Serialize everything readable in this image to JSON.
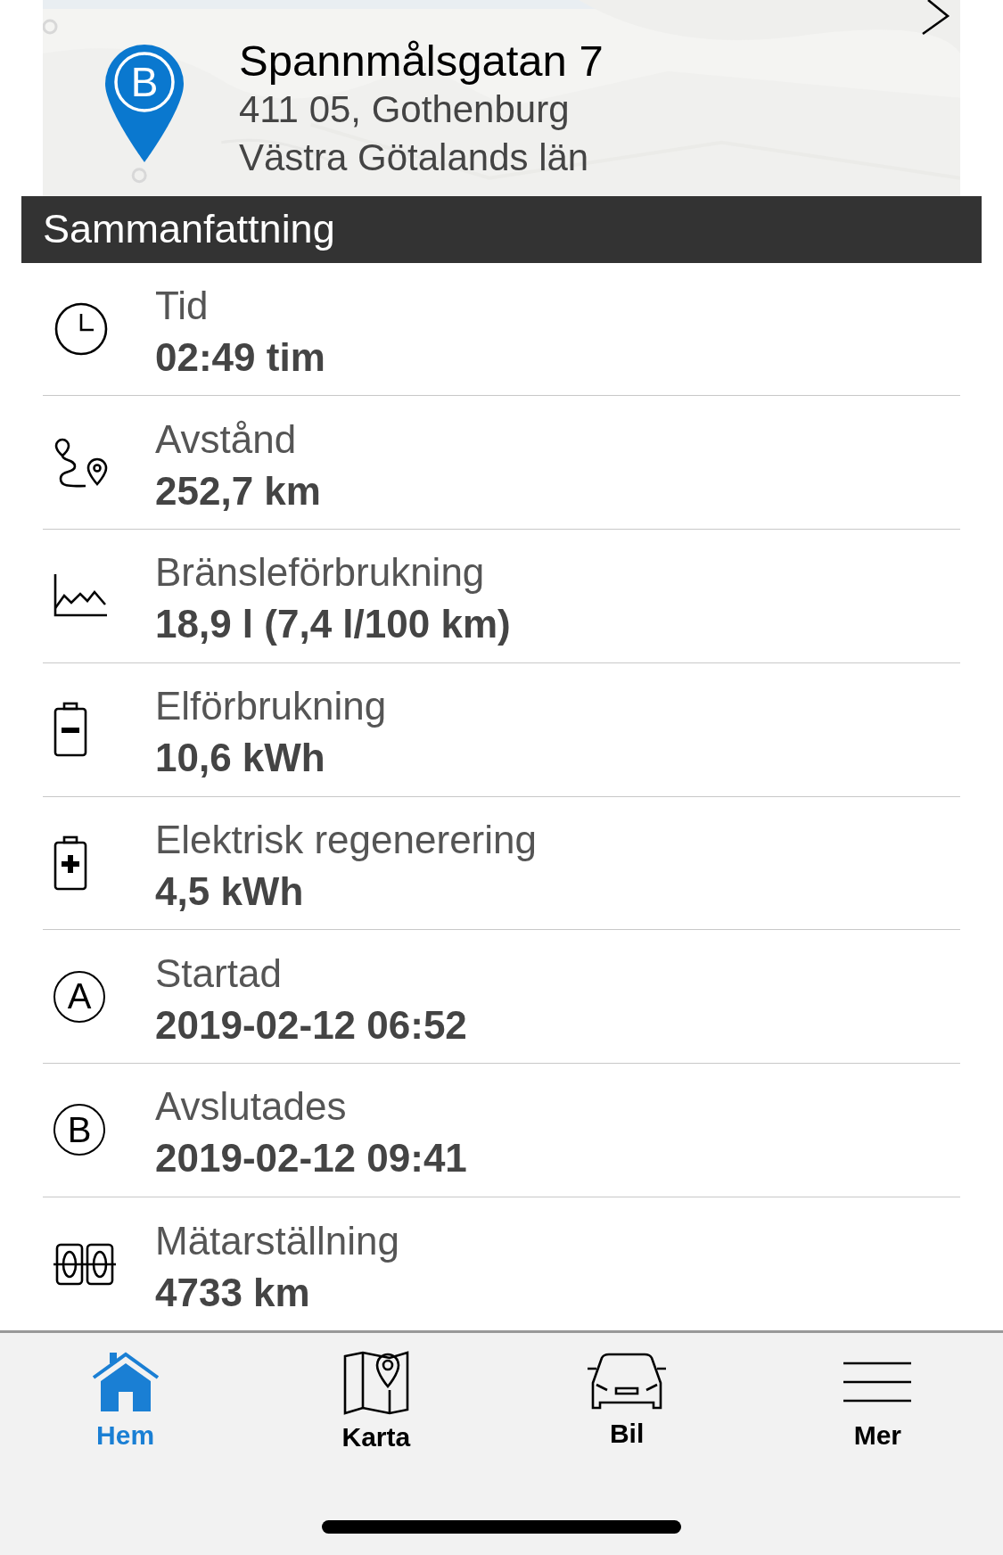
{
  "location": {
    "pin_letter": "B",
    "street": "Spannmålsgatan 7",
    "postal": "411 05, Gothenburg",
    "region": "Västra Götalands län"
  },
  "summary": {
    "title": "Sammanfattning",
    "rows": [
      {
        "kind": "clock",
        "label": "Tid",
        "value": "02:49 tim"
      },
      {
        "kind": "route",
        "label": "Avstånd",
        "value": "252,7 km"
      },
      {
        "kind": "chart",
        "label": "Bränsleförbrukning",
        "value": "18,9 l (7,4 l/100 km)"
      },
      {
        "kind": "battery-minus",
        "label": "Elförbrukning",
        "value": "10,6 kWh"
      },
      {
        "kind": "battery-plus",
        "label": "Elektrisk regenerering",
        "value": "4,5 kWh"
      },
      {
        "kind": "letter",
        "letter": "A",
        "label": "Startad",
        "value": "2019-02-12 06:52"
      },
      {
        "kind": "letter",
        "letter": "B",
        "label": "Avslutades",
        "value": "2019-02-12 09:41"
      },
      {
        "kind": "odometer",
        "label": "Mätarställning",
        "value": "4733 km"
      }
    ]
  },
  "nav": [
    {
      "kind": "home",
      "label": "Hem",
      "selected": true
    },
    {
      "kind": "map",
      "label": "Karta",
      "selected": false
    },
    {
      "kind": "car",
      "label": "Bil",
      "selected": false
    },
    {
      "kind": "menu",
      "label": "Mer",
      "selected": false
    }
  ]
}
